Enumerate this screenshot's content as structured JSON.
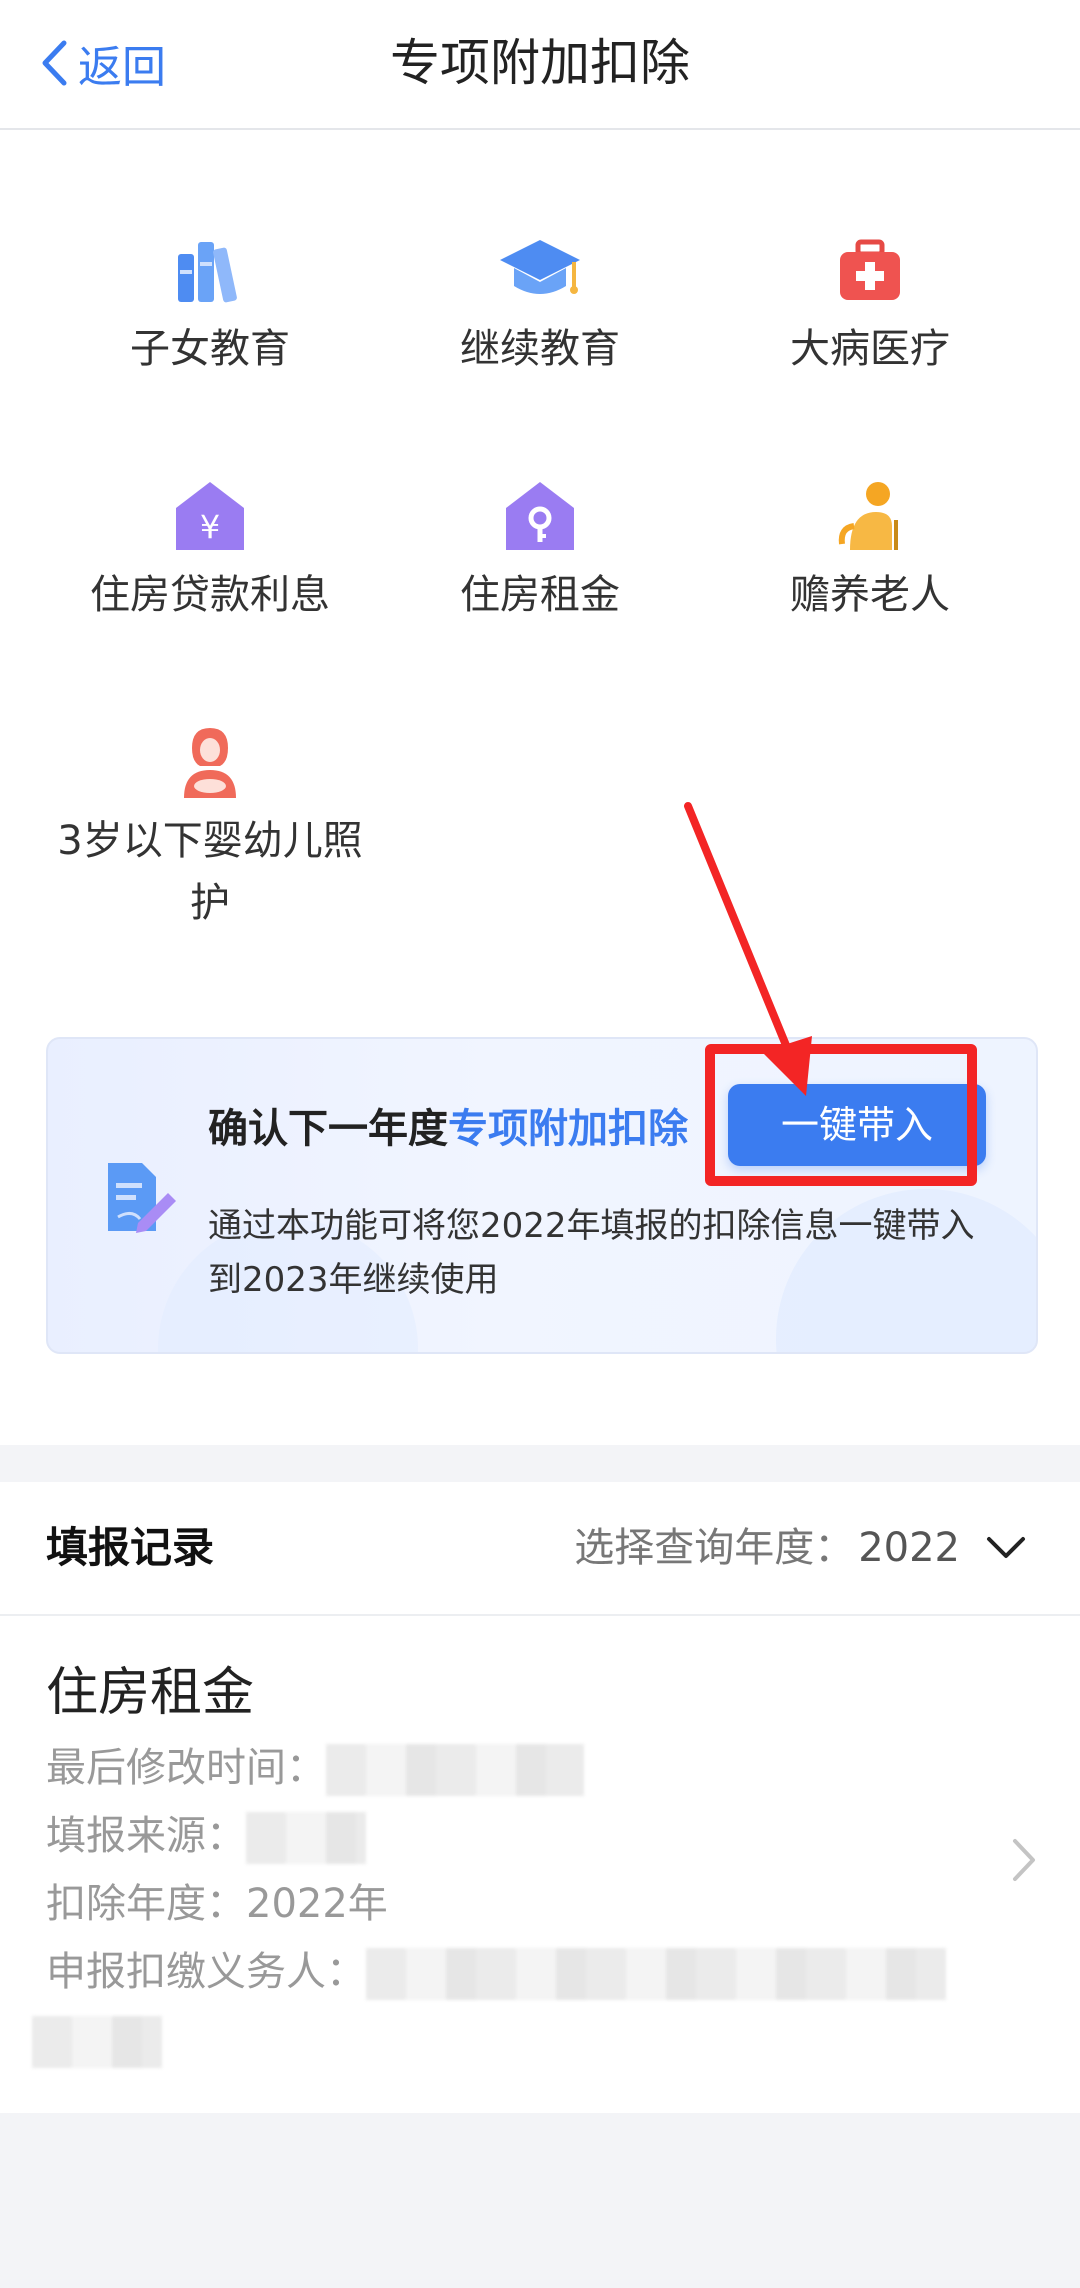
{
  "nav": {
    "back_label": "返回",
    "title": "专项附加扣除"
  },
  "categories": [
    {
      "label": "子女教育",
      "icon": "books-icon",
      "color": "#4e8cf2"
    },
    {
      "label": "继续教育",
      "icon": "graduation-cap-icon",
      "color": "#4e8cf2"
    },
    {
      "label": "大病医疗",
      "icon": "first-aid-kit-icon",
      "color": "#ef5350"
    },
    {
      "label": "住房贷款利息",
      "icon": "house-yuan-icon",
      "color": "#9a7cf2"
    },
    {
      "label": "住房租金",
      "icon": "house-key-icon",
      "color": "#9a7cf2"
    },
    {
      "label": "赡养老人",
      "icon": "elderly-person-icon",
      "color": "#f5a623"
    },
    {
      "label": "3岁以下婴幼儿照护",
      "icon": "mother-baby-icon",
      "color": "#f06a5a"
    }
  ],
  "banner": {
    "heading_prefix": "确认下一年度",
    "heading_highlight": "专项附加扣除",
    "button_label": "一键带入",
    "description": "通过本功能可将您2022年填报的扣除信息一键带入到2023年继续使用"
  },
  "records": {
    "heading": "填报记录",
    "year_selector_label": "选择查询年度：",
    "year_selector_value": "2022",
    "items": [
      {
        "title": "住房租金",
        "modified_label": "最后修改时间：",
        "source_label": "填报来源：",
        "deduction_year_label": "扣除年度：",
        "deduction_year_value": "2022年",
        "withholder_label": "申报扣缴义务人："
      }
    ]
  },
  "colors": {
    "accent": "#3b7cf0",
    "annotation_red": "#f32525"
  }
}
